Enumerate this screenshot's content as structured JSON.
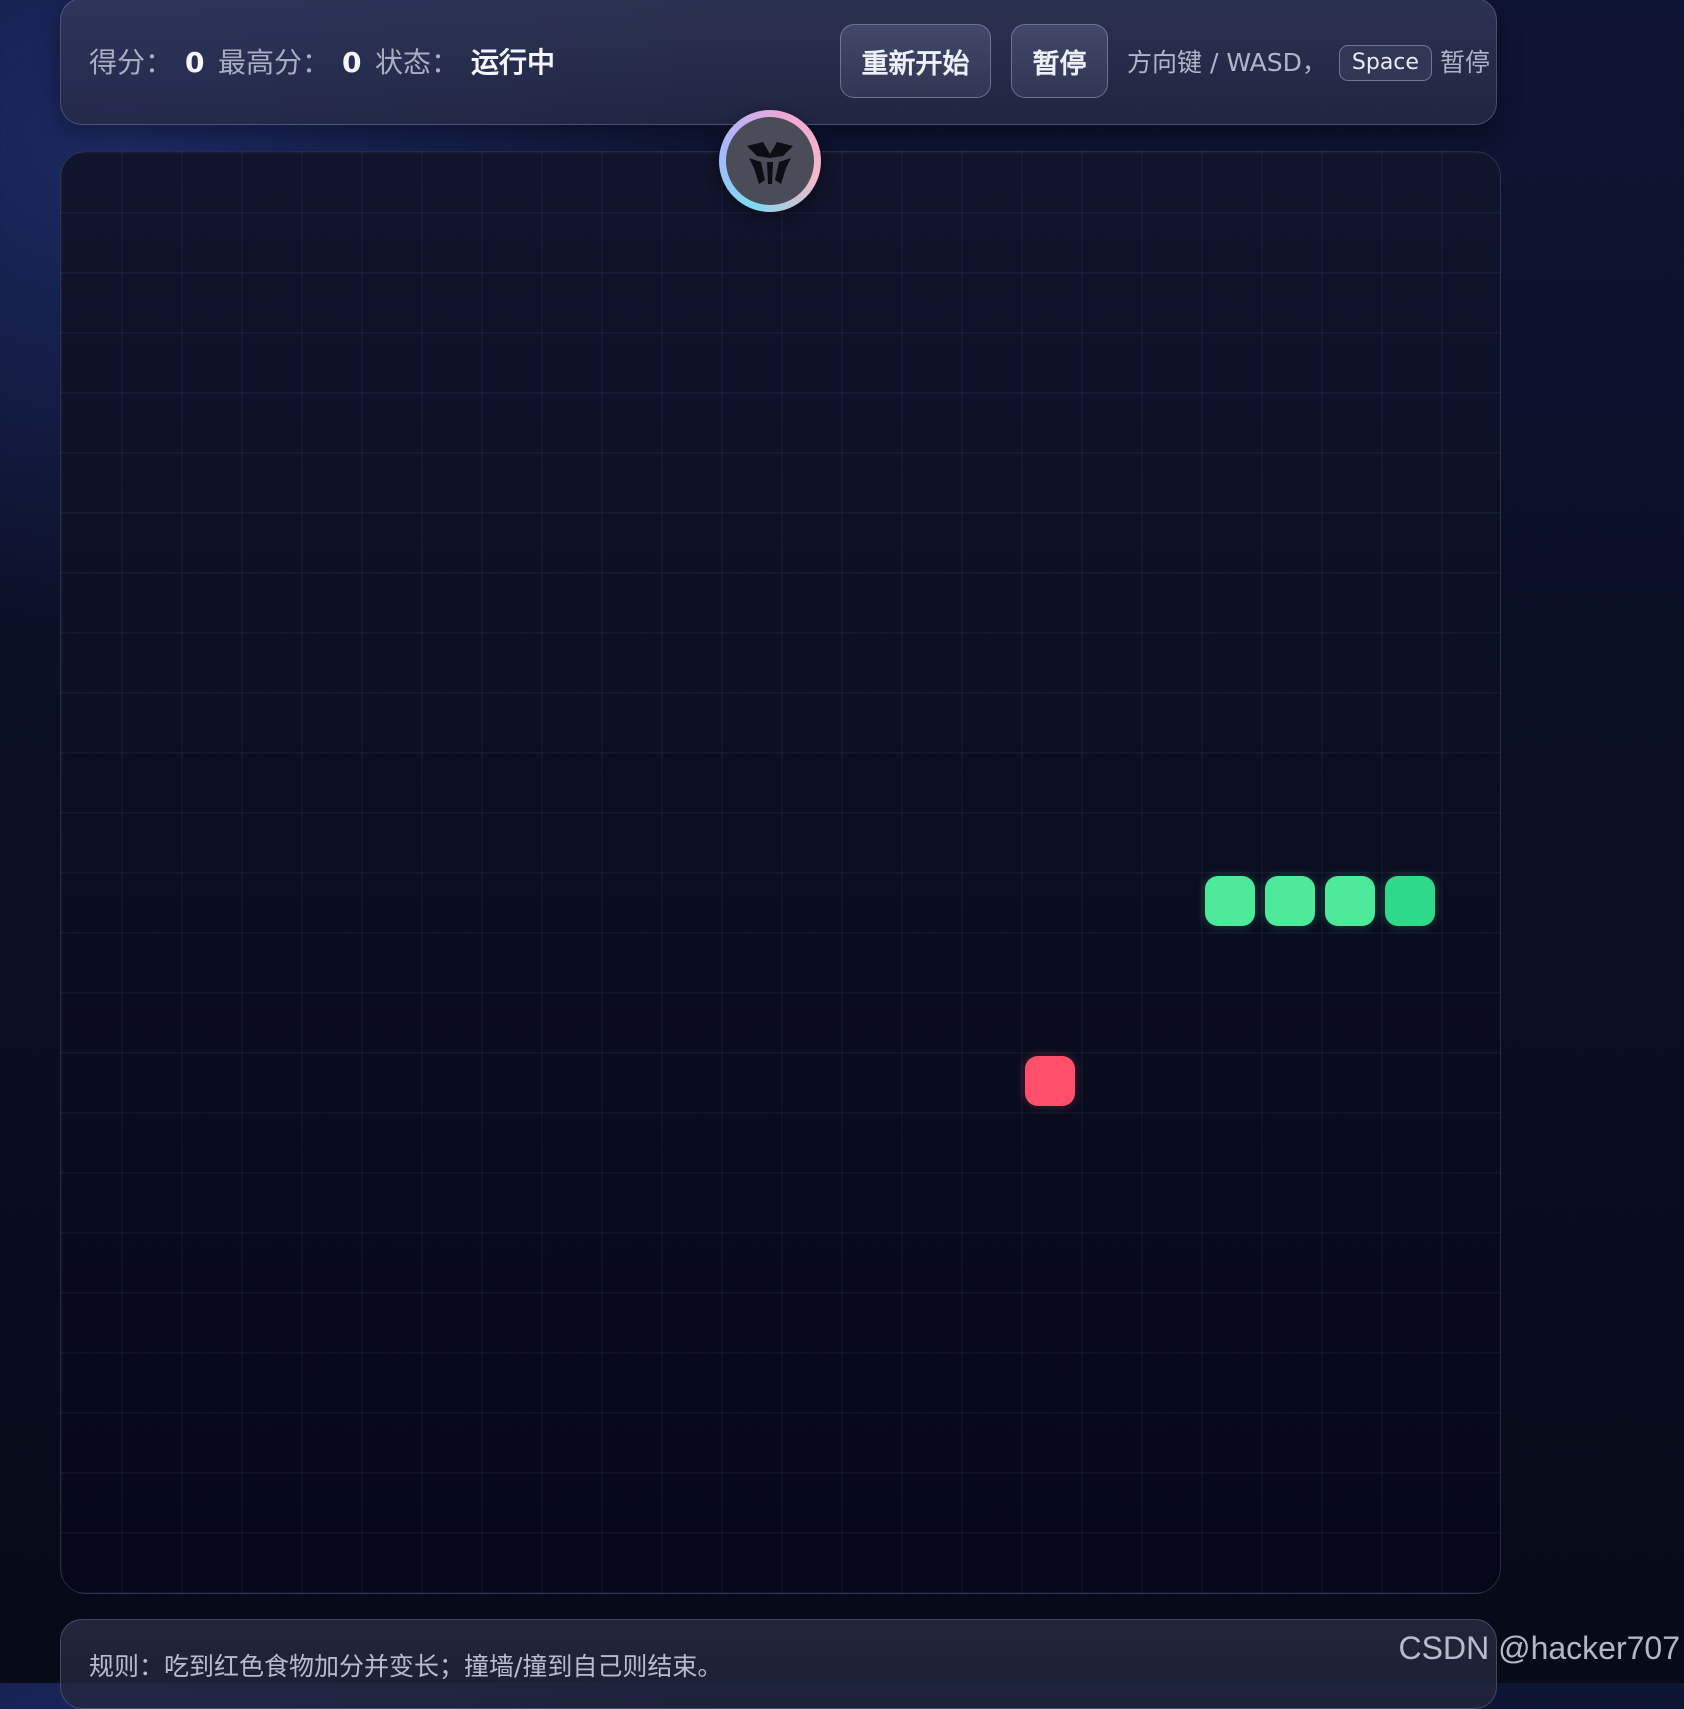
{
  "stats": {
    "score_label": "得分：",
    "score_value": "0",
    "best_label": "最高分：",
    "best_value": "0",
    "status_label": "状态：",
    "status_value": "运行中"
  },
  "controls": {
    "restart_label": "重新开始",
    "pause_label": "暂停",
    "hint_prefix": "方向键 / WASD，",
    "hint_key": "Space",
    "hint_suffix": "暂停"
  },
  "badge": {
    "icon": "y-logo-icon"
  },
  "board": {
    "grid_columns": 24,
    "grid_rows": 24,
    "snake": [
      {
        "col": 22,
        "row": 12,
        "head": true
      },
      {
        "col": 21,
        "row": 12,
        "head": false
      },
      {
        "col": 20,
        "row": 12,
        "head": false
      },
      {
        "col": 19,
        "row": 12,
        "head": false
      }
    ],
    "food": {
      "col": 16,
      "row": 15
    },
    "colors": {
      "snake_body": "#4eea9c",
      "snake_head": "#2fd98a",
      "food": "#ff4f6a"
    }
  },
  "rules": {
    "text": "规则：吃到红色食物加分并变长；撞墙/撞到自己则结束。"
  },
  "watermark": {
    "text": "CSDN @hacker707"
  }
}
